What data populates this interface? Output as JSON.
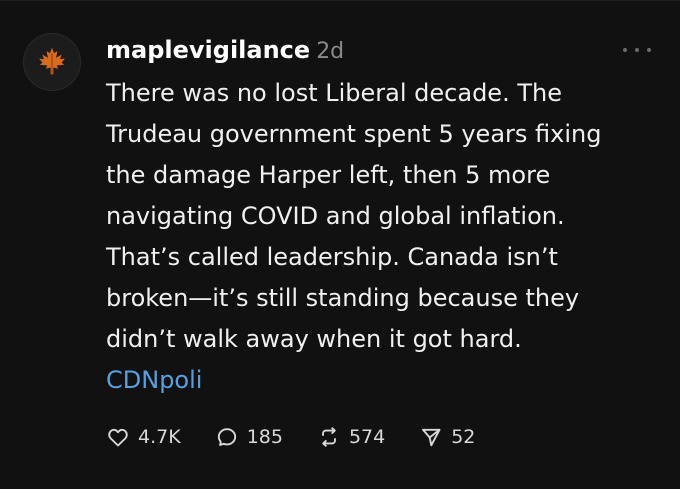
{
  "post": {
    "username": "maplevigilance",
    "time_ago": "2d",
    "lines": [
      "There was no lost Liberal decade. The",
      "Trudeau government spent 5 years fixing",
      "the damage Harper left, then 5 more",
      "navigating COVID and global inflation.",
      "That’s called leadership. Canada isn’t",
      "broken—it’s still standing because they",
      "didn’t walk away when it got hard."
    ],
    "tag": "CDNpoli",
    "avatar_icon": "maple-leaf-icon",
    "menu_icon": "more-options-icon"
  },
  "actions": [
    {
      "icon": "heart-icon",
      "count": "4.7K"
    },
    {
      "icon": "comment-icon",
      "count": "185"
    },
    {
      "icon": "repost-icon",
      "count": "574"
    },
    {
      "icon": "share-icon",
      "count": "52"
    }
  ],
  "colors": {
    "background": "#111111",
    "text": "#f0f0f0",
    "muted": "#8a8a8a",
    "tag": "#56a0e0",
    "avatar_leaf": "#d96b1f"
  }
}
